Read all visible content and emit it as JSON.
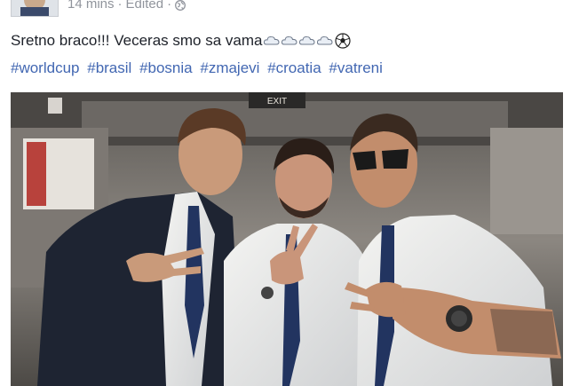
{
  "post": {
    "timestamp": "14 mins",
    "separator": "·",
    "edited_label": "Edited",
    "separator2": "·",
    "message": "Sretno braco!!! Veceras smo sa vama",
    "emoji_icons": [
      "cloud-emoji",
      "cloud-emoji",
      "cloud-emoji",
      "cloud-emoji",
      "soccer-ball-emoji"
    ],
    "hashtags": [
      "#worldcup",
      "#brasil",
      "#bosnia",
      "#zmajevi",
      "#croatia",
      "#vatreni"
    ],
    "photo": {
      "exit_sign": "EXIT"
    }
  },
  "colors": {
    "text": "#1d2129",
    "meta": "#90949c",
    "link": "#4267b2"
  }
}
